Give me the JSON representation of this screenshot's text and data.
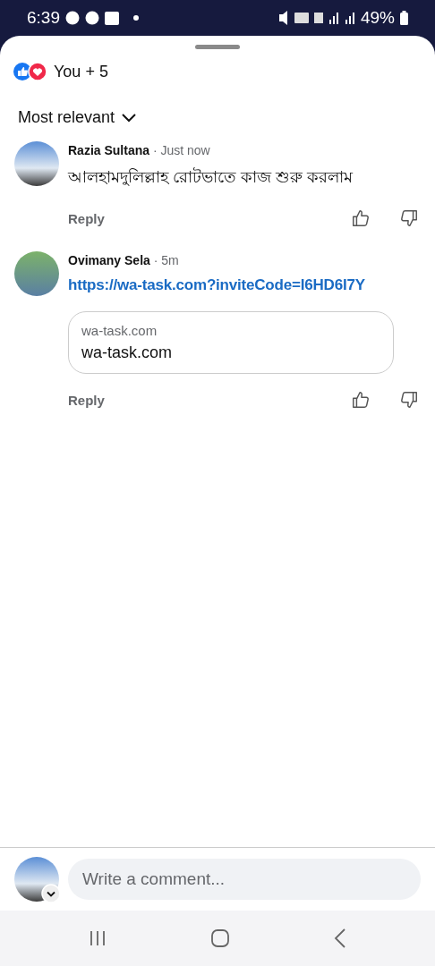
{
  "status_bar": {
    "time": "6:39",
    "battery": "49%"
  },
  "reactions": {
    "summary": "You + 5"
  },
  "sort": {
    "label": "Most relevant"
  },
  "comments": [
    {
      "author": "Razia Sultana",
      "time": "· Just now",
      "kind": "text",
      "body": "আলহামদুলিল্লাহ রোটভাতে কাজ শুরু করলাম",
      "reply": "Reply"
    },
    {
      "author": "Ovimany Sela",
      "time": "· 5m",
      "kind": "link",
      "body": "https://wa-task.com?inviteCode=I6HD6I7Y",
      "preview": {
        "domain": "wa-task.com",
        "title": "wa-task.com"
      },
      "reply": "Reply"
    }
  ],
  "composer": {
    "placeholder": "Write a comment..."
  }
}
